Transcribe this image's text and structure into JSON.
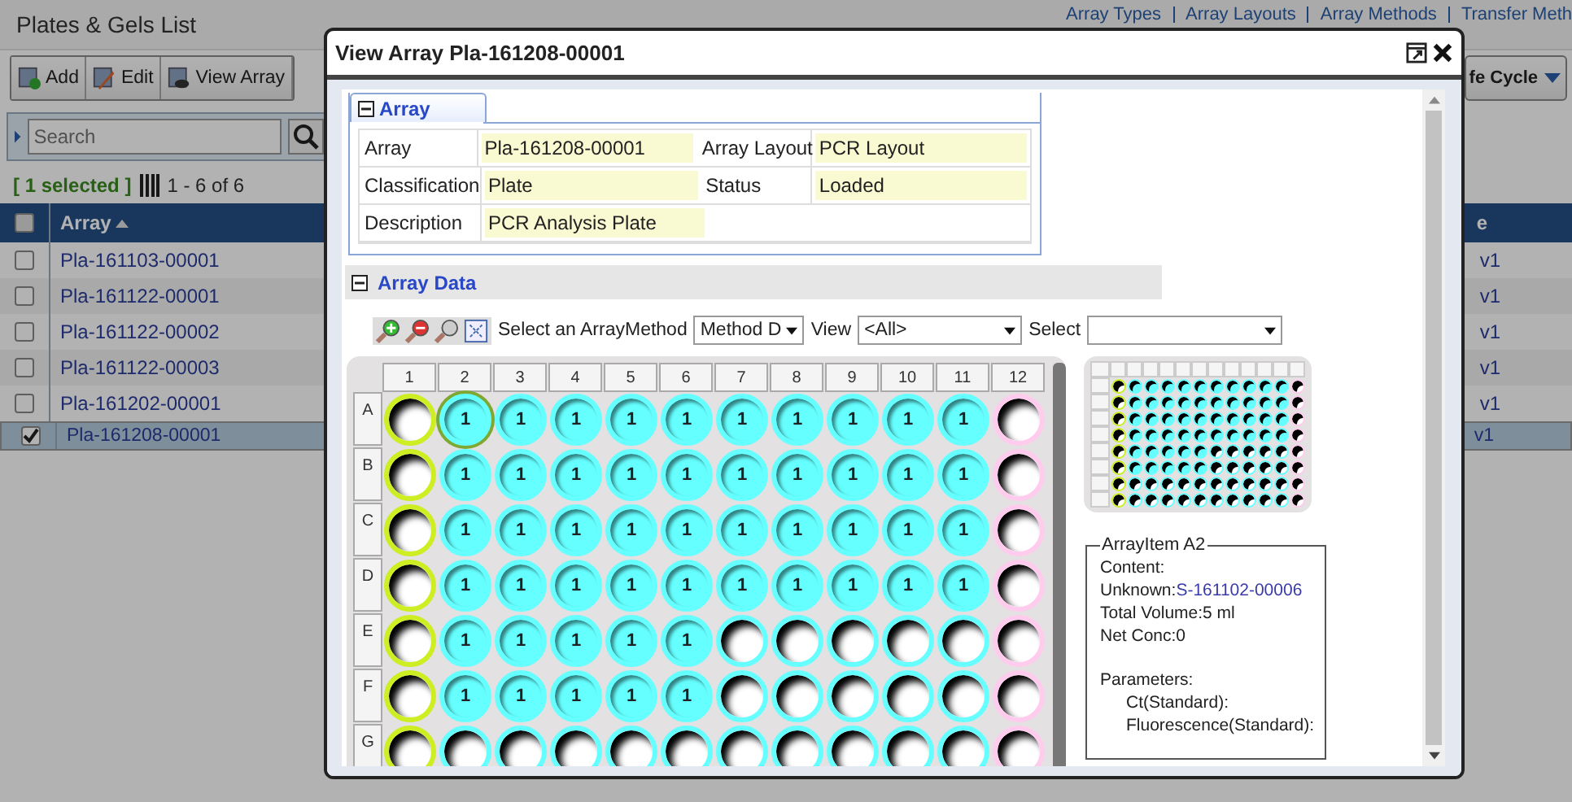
{
  "page": {
    "title": "Plates & Gels List",
    "links": [
      "Array Types",
      "Array Layouts",
      "Array Methods",
      "Transfer Meth"
    ],
    "toolbar": [
      {
        "label": "Add",
        "kind": "add"
      },
      {
        "label": "Edit",
        "kind": "edit"
      },
      {
        "label": "View Array",
        "kind": "view"
      }
    ],
    "lifecycle_button": "fe Cycle",
    "search": {
      "placeholder": "Search"
    },
    "selection": "[ 1 selected ]",
    "paging": "1 - 6 of 6",
    "table": {
      "all_checked": false,
      "columns": [
        "Array",
        "e"
      ],
      "rows": [
        {
          "array": "Pla-161103-00001",
          "column_2": "v1",
          "checked": false
        },
        {
          "array": "Pla-161122-00001",
          "column_2": "v1",
          "checked": false
        },
        {
          "array": "Pla-161122-00002",
          "column_2": "v1",
          "checked": false
        },
        {
          "array": "Pla-161122-00003",
          "column_2": "v1",
          "checked": false
        },
        {
          "array": "Pla-161202-00001",
          "column_2": "v1",
          "checked": false
        },
        {
          "array": "Pla-161208-00001",
          "column_2": "v1",
          "checked": true
        }
      ]
    }
  },
  "dialog": {
    "title": "View Array Pla-161208-00001",
    "section_tab": "Array",
    "properties": [
      [
        {
          "label": "Array",
          "value": "Pla-161208-00001"
        },
        {
          "label": "Array Layout",
          "value": "PCR Layout"
        }
      ],
      [
        {
          "label": "Classification",
          "value": "Plate"
        },
        {
          "label": "Status",
          "value": "Loaded"
        }
      ],
      [
        {
          "label": "Description",
          "value": "PCR Analysis Plate"
        }
      ]
    ],
    "data_section": "Array Data",
    "method_label": "Select an ArrayMethod",
    "method": "Method D",
    "view_label": "View",
    "view": "<All>",
    "select_label": "Select",
    "plate": {
      "columns": [
        "1",
        "2",
        "3",
        "4",
        "5",
        "6",
        "7",
        "8",
        "9",
        "10",
        "11",
        "12"
      ],
      "rows": [
        {
          "label": "A",
          "wells": [
            {
              "color": "#ccee22",
              "filled": false,
              "selected": false
            },
            {
              "color": "#66ffff",
              "filled": true,
              "label": "1",
              "selected": true
            },
            {
              "color": "#66ffff",
              "filled": true,
              "label": "1",
              "selected": false
            },
            {
              "color": "#66ffff",
              "filled": true,
              "label": "1",
              "selected": false
            },
            {
              "color": "#66ffff",
              "filled": true,
              "label": "1",
              "selected": false
            },
            {
              "color": "#66ffff",
              "filled": true,
              "label": "1",
              "selected": false
            },
            {
              "color": "#66ffff",
              "filled": true,
              "label": "1",
              "selected": false
            },
            {
              "color": "#66ffff",
              "filled": true,
              "label": "1",
              "selected": false
            },
            {
              "color": "#66ffff",
              "filled": true,
              "label": "1",
              "selected": false
            },
            {
              "color": "#66ffff",
              "filled": true,
              "label": "1",
              "selected": false
            },
            {
              "color": "#66ffff",
              "filled": true,
              "label": "1",
              "selected": false
            },
            {
              "color": "#ffccee",
              "filled": false,
              "selected": false
            }
          ]
        },
        {
          "label": "B",
          "wells": [
            {
              "color": "#ccee22",
              "filled": false,
              "selected": false
            },
            {
              "color": "#66ffff",
              "filled": true,
              "label": "1",
              "selected": false
            },
            {
              "color": "#66ffff",
              "filled": true,
              "label": "1",
              "selected": false
            },
            {
              "color": "#66ffff",
              "filled": true,
              "label": "1",
              "selected": false
            },
            {
              "color": "#66ffff",
              "filled": true,
              "label": "1",
              "selected": false
            },
            {
              "color": "#66ffff",
              "filled": true,
              "label": "1",
              "selected": false
            },
            {
              "color": "#66ffff",
              "filled": true,
              "label": "1",
              "selected": false
            },
            {
              "color": "#66ffff",
              "filled": true,
              "label": "1",
              "selected": false
            },
            {
              "color": "#66ffff",
              "filled": true,
              "label": "1",
              "selected": false
            },
            {
              "color": "#66ffff",
              "filled": true,
              "label": "1",
              "selected": false
            },
            {
              "color": "#66ffff",
              "filled": true,
              "label": "1",
              "selected": false
            },
            {
              "color": "#ffccee",
              "filled": false,
              "selected": false
            }
          ]
        },
        {
          "label": "C",
          "wells": [
            {
              "color": "#ccee22",
              "filled": false,
              "selected": false
            },
            {
              "color": "#66ffff",
              "filled": true,
              "label": "1",
              "selected": false
            },
            {
              "color": "#66ffff",
              "filled": true,
              "label": "1",
              "selected": false
            },
            {
              "color": "#66ffff",
              "filled": true,
              "label": "1",
              "selected": false
            },
            {
              "color": "#66ffff",
              "filled": true,
              "label": "1",
              "selected": false
            },
            {
              "color": "#66ffff",
              "filled": true,
              "label": "1",
              "selected": false
            },
            {
              "color": "#66ffff",
              "filled": true,
              "label": "1",
              "selected": false
            },
            {
              "color": "#66ffff",
              "filled": true,
              "label": "1",
              "selected": false
            },
            {
              "color": "#66ffff",
              "filled": true,
              "label": "1",
              "selected": false
            },
            {
              "color": "#66ffff",
              "filled": true,
              "label": "1",
              "selected": false
            },
            {
              "color": "#66ffff",
              "filled": true,
              "label": "1",
              "selected": false
            },
            {
              "color": "#ffccee",
              "filled": false,
              "selected": false
            }
          ]
        },
        {
          "label": "D",
          "wells": [
            {
              "color": "#ccee22",
              "filled": false,
              "selected": false
            },
            {
              "color": "#66ffff",
              "filled": true,
              "label": "1",
              "selected": false
            },
            {
              "color": "#66ffff",
              "filled": true,
              "label": "1",
              "selected": false
            },
            {
              "color": "#66ffff",
              "filled": true,
              "label": "1",
              "selected": false
            },
            {
              "color": "#66ffff",
              "filled": true,
              "label": "1",
              "selected": false
            },
            {
              "color": "#66ffff",
              "filled": true,
              "label": "1",
              "selected": false
            },
            {
              "color": "#66ffff",
              "filled": true,
              "label": "1",
              "selected": false
            },
            {
              "color": "#66ffff",
              "filled": true,
              "label": "1",
              "selected": false
            },
            {
              "color": "#66ffff",
              "filled": true,
              "label": "1",
              "selected": false
            },
            {
              "color": "#66ffff",
              "filled": true,
              "label": "1",
              "selected": false
            },
            {
              "color": "#66ffff",
              "filled": true,
              "label": "1",
              "selected": false
            },
            {
              "color": "#ffccee",
              "filled": false,
              "selected": false
            }
          ]
        },
        {
          "label": "E",
          "wells": [
            {
              "color": "#ccee22",
              "filled": false,
              "selected": false
            },
            {
              "color": "#66ffff",
              "filled": true,
              "label": "1",
              "selected": false
            },
            {
              "color": "#66ffff",
              "filled": true,
              "label": "1",
              "selected": false
            },
            {
              "color": "#66ffff",
              "filled": true,
              "label": "1",
              "selected": false
            },
            {
              "color": "#66ffff",
              "filled": true,
              "label": "1",
              "selected": false
            },
            {
              "color": "#66ffff",
              "filled": true,
              "label": "1",
              "selected": false
            },
            {
              "color": "#66ffff",
              "filled": false,
              "selected": false
            },
            {
              "color": "#66ffff",
              "filled": false,
              "selected": false
            },
            {
              "color": "#66ffff",
              "filled": false,
              "selected": false
            },
            {
              "color": "#66ffff",
              "filled": false,
              "selected": false
            },
            {
              "color": "#66ffff",
              "filled": false,
              "selected": false
            },
            {
              "color": "#ffccee",
              "filled": false,
              "selected": false
            }
          ]
        },
        {
          "label": "F",
          "wells": [
            {
              "color": "#ccee22",
              "filled": false,
              "selected": false
            },
            {
              "color": "#66ffff",
              "filled": true,
              "label": "1",
              "selected": false
            },
            {
              "color": "#66ffff",
              "filled": true,
              "label": "1",
              "selected": false
            },
            {
              "color": "#66ffff",
              "filled": true,
              "label": "1",
              "selected": false
            },
            {
              "color": "#66ffff",
              "filled": true,
              "label": "1",
              "selected": false
            },
            {
              "color": "#66ffff",
              "filled": true,
              "label": "1",
              "selected": false
            },
            {
              "color": "#66ffff",
              "filled": false,
              "selected": false
            },
            {
              "color": "#66ffff",
              "filled": false,
              "selected": false
            },
            {
              "color": "#66ffff",
              "filled": false,
              "selected": false
            },
            {
              "color": "#66ffff",
              "filled": false,
              "selected": false
            },
            {
              "color": "#66ffff",
              "filled": false,
              "selected": false
            },
            {
              "color": "#ffccee",
              "filled": false,
              "selected": false
            }
          ]
        },
        {
          "label": "G",
          "wells": [
            {
              "color": "#ccee22",
              "filled": false,
              "selected": false
            },
            {
              "color": "#66ffff",
              "filled": false,
              "selected": false
            },
            {
              "color": "#66ffff",
              "filled": false,
              "selected": false
            },
            {
              "color": "#66ffff",
              "filled": false,
              "selected": false
            },
            {
              "color": "#66ffff",
              "filled": false,
              "selected": false
            },
            {
              "color": "#66ffff",
              "filled": false,
              "selected": false
            },
            {
              "color": "#66ffff",
              "filled": false,
              "selected": false
            },
            {
              "color": "#66ffff",
              "filled": false,
              "selected": false
            },
            {
              "color": "#66ffff",
              "filled": false,
              "selected": false
            },
            {
              "color": "#66ffff",
              "filled": false,
              "selected": false
            },
            {
              "color": "#66ffff",
              "filled": false,
              "selected": false
            },
            {
              "color": "#ffccee",
              "filled": false,
              "selected": false
            }
          ]
        }
      ]
    },
    "overview": {
      "rows": [
        [
          {
            "color": "#ccee22",
            "filled": false
          },
          {
            "color": "#66ffff",
            "filled": true
          },
          {
            "color": "#66ffff",
            "filled": true
          },
          {
            "color": "#66ffff",
            "filled": true
          },
          {
            "color": "#66ffff",
            "filled": true
          },
          {
            "color": "#66ffff",
            "filled": true
          },
          {
            "color": "#66ffff",
            "filled": true
          },
          {
            "color": "#66ffff",
            "filled": true
          },
          {
            "color": "#66ffff",
            "filled": true
          },
          {
            "color": "#66ffff",
            "filled": true
          },
          {
            "color": "#66ffff",
            "filled": true
          },
          {
            "color": "#ffccee",
            "filled": false
          }
        ],
        [
          {
            "color": "#ccee22",
            "filled": false
          },
          {
            "color": "#66ffff",
            "filled": true
          },
          {
            "color": "#66ffff",
            "filled": true
          },
          {
            "color": "#66ffff",
            "filled": true
          },
          {
            "color": "#66ffff",
            "filled": true
          },
          {
            "color": "#66ffff",
            "filled": true
          },
          {
            "color": "#66ffff",
            "filled": true
          },
          {
            "color": "#66ffff",
            "filled": true
          },
          {
            "color": "#66ffff",
            "filled": true
          },
          {
            "color": "#66ffff",
            "filled": true
          },
          {
            "color": "#66ffff",
            "filled": true
          },
          {
            "color": "#ffccee",
            "filled": false
          }
        ],
        [
          {
            "color": "#ccee22",
            "filled": false
          },
          {
            "color": "#66ffff",
            "filled": true
          },
          {
            "color": "#66ffff",
            "filled": true
          },
          {
            "color": "#66ffff",
            "filled": true
          },
          {
            "color": "#66ffff",
            "filled": true
          },
          {
            "color": "#66ffff",
            "filled": true
          },
          {
            "color": "#66ffff",
            "filled": true
          },
          {
            "color": "#66ffff",
            "filled": true
          },
          {
            "color": "#66ffff",
            "filled": true
          },
          {
            "color": "#66ffff",
            "filled": true
          },
          {
            "color": "#66ffff",
            "filled": true
          },
          {
            "color": "#ffccee",
            "filled": false
          }
        ],
        [
          {
            "color": "#ccee22",
            "filled": false
          },
          {
            "color": "#66ffff",
            "filled": true
          },
          {
            "color": "#66ffff",
            "filled": true
          },
          {
            "color": "#66ffff",
            "filled": true
          },
          {
            "color": "#66ffff",
            "filled": true
          },
          {
            "color": "#66ffff",
            "filled": true
          },
          {
            "color": "#66ffff",
            "filled": true
          },
          {
            "color": "#66ffff",
            "filled": true
          },
          {
            "color": "#66ffff",
            "filled": true
          },
          {
            "color": "#66ffff",
            "filled": true
          },
          {
            "color": "#66ffff",
            "filled": true
          },
          {
            "color": "#ffccee",
            "filled": false
          }
        ],
        [
          {
            "color": "#ccee22",
            "filled": false
          },
          {
            "color": "#66ffff",
            "filled": true
          },
          {
            "color": "#66ffff",
            "filled": true
          },
          {
            "color": "#66ffff",
            "filled": true
          },
          {
            "color": "#66ffff",
            "filled": true
          },
          {
            "color": "#66ffff",
            "filled": true
          },
          {
            "color": "#66ffff",
            "filled": false
          },
          {
            "color": "#66ffff",
            "filled": false
          },
          {
            "color": "#66ffff",
            "filled": false
          },
          {
            "color": "#66ffff",
            "filled": false
          },
          {
            "color": "#66ffff",
            "filled": false
          },
          {
            "color": "#ffccee",
            "filled": false
          }
        ],
        [
          {
            "color": "#ccee22",
            "filled": false
          },
          {
            "color": "#66ffff",
            "filled": true
          },
          {
            "color": "#66ffff",
            "filled": true
          },
          {
            "color": "#66ffff",
            "filled": true
          },
          {
            "color": "#66ffff",
            "filled": true
          },
          {
            "color": "#66ffff",
            "filled": true
          },
          {
            "color": "#66ffff",
            "filled": false
          },
          {
            "color": "#66ffff",
            "filled": false
          },
          {
            "color": "#66ffff",
            "filled": false
          },
          {
            "color": "#66ffff",
            "filled": false
          },
          {
            "color": "#66ffff",
            "filled": false
          },
          {
            "color": "#ffccee",
            "filled": false
          }
        ],
        [
          {
            "color": "#ccee22",
            "filled": false
          },
          {
            "color": "#66ffff",
            "filled": false
          },
          {
            "color": "#66ffff",
            "filled": false
          },
          {
            "color": "#66ffff",
            "filled": false
          },
          {
            "color": "#66ffff",
            "filled": false
          },
          {
            "color": "#66ffff",
            "filled": false
          },
          {
            "color": "#66ffff",
            "filled": false
          },
          {
            "color": "#66ffff",
            "filled": false
          },
          {
            "color": "#66ffff",
            "filled": false
          },
          {
            "color": "#66ffff",
            "filled": false
          },
          {
            "color": "#66ffff",
            "filled": false
          },
          {
            "color": "#ffccee",
            "filled": false
          }
        ],
        [
          {
            "color": "#ccee22",
            "filled": false
          },
          {
            "color": "#66ffff",
            "filled": false
          },
          {
            "color": "#66ffff",
            "filled": false
          },
          {
            "color": "#66ffff",
            "filled": false
          },
          {
            "color": "#66ffff",
            "filled": false
          },
          {
            "color": "#66ffff",
            "filled": false
          },
          {
            "color": "#66ffff",
            "filled": false
          },
          {
            "color": "#66ffff",
            "filled": false
          },
          {
            "color": "#66ffff",
            "filled": false
          },
          {
            "color": "#66ffff",
            "filled": false
          },
          {
            "color": "#66ffff",
            "filled": false
          },
          {
            "color": "#ffccee",
            "filled": false
          }
        ]
      ]
    },
    "item": {
      "title": "ArrayItem A2",
      "content_label": "Content:",
      "unknown_label": "Unknown:",
      "unknown_link": "S-161102-00006",
      "volume": "Total Volume:5 ml",
      "conc": "Net Conc:0",
      "parameters_label": "Parameters:",
      "parameters": [
        "Ct(Standard):",
        "Fluorescence(Standard):"
      ]
    }
  }
}
